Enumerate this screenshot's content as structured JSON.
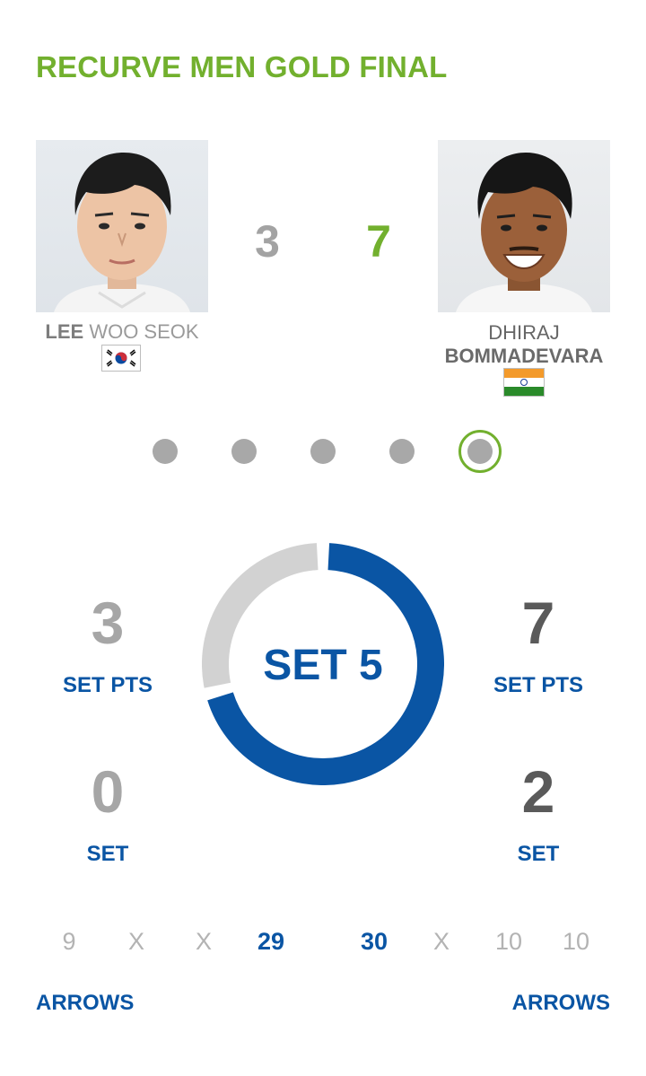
{
  "theme": {
    "green": "#72b02e",
    "blue": "#0a55a4",
    "ring_grey": "#d2d2d2"
  },
  "title": "RECURVE MEN GOLD FINAL",
  "match_score": {
    "left": "3",
    "right": "7"
  },
  "athletes": {
    "left": {
      "family_name": "LEE",
      "given_name": "WOO SEOK",
      "flag": "south-korea-flag"
    },
    "right": {
      "given_name": "DHIRAJ",
      "family_name": "BOMMADEVARA",
      "flag": "india-flag"
    }
  },
  "set_selector": {
    "count": 5,
    "active_index": 5
  },
  "current_set": {
    "label": "SET 5",
    "ring_fill_fraction": 0.71,
    "left": {
      "set_pts": "3",
      "set_pts_label": "SET PTS",
      "set": "0",
      "set_label": "SET"
    },
    "right": {
      "set_pts": "7",
      "set_pts_label": "SET PTS",
      "set": "2",
      "set_label": "SET"
    }
  },
  "arrows": {
    "label": "ARROWS",
    "left": {
      "values": [
        "9",
        "X",
        "X"
      ],
      "total": "29"
    },
    "right": {
      "total": "30",
      "values": [
        "X",
        "10",
        "10"
      ]
    }
  }
}
